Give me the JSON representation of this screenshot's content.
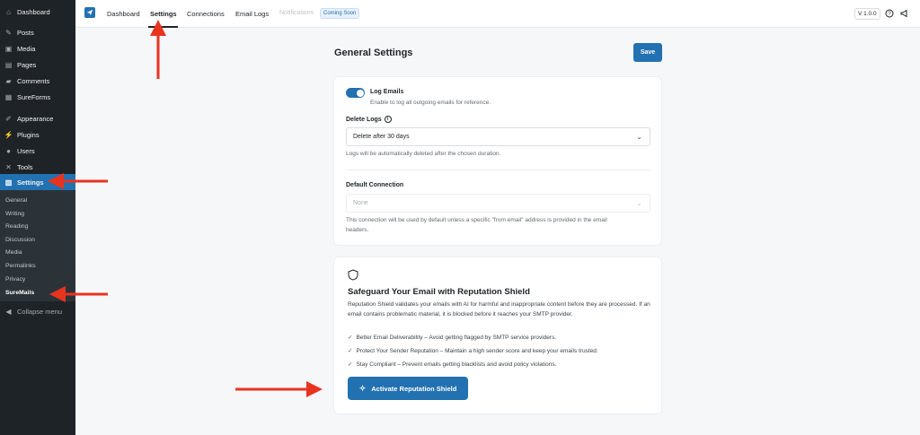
{
  "sidebar": {
    "items": [
      {
        "label": "Dashboard",
        "icon": "dashboard-icon",
        "glyph": "⌂"
      },
      {
        "label": "Posts",
        "icon": "pin-icon",
        "glyph": "✎"
      },
      {
        "label": "Media",
        "icon": "media-icon",
        "glyph": "▣"
      },
      {
        "label": "Pages",
        "icon": "pages-icon",
        "glyph": "▤"
      },
      {
        "label": "Comments",
        "icon": "comments-icon",
        "glyph": "▰"
      },
      {
        "label": "SureForms",
        "icon": "sureforms-icon",
        "glyph": "▦"
      },
      {
        "label": "Appearance",
        "icon": "brush-icon",
        "glyph": "✐"
      },
      {
        "label": "Plugins",
        "icon": "plugin-icon",
        "glyph": "⚡"
      },
      {
        "label": "Users",
        "icon": "users-icon",
        "glyph": "●"
      },
      {
        "label": "Tools",
        "icon": "wrench-icon",
        "glyph": "✕"
      },
      {
        "label": "Settings",
        "icon": "settings-icon",
        "glyph": "▥"
      }
    ],
    "submenu": [
      "General",
      "Writing",
      "Reading",
      "Discussion",
      "Media",
      "Permalinks",
      "Privacy",
      "SureMails"
    ],
    "collapse_label": "Collapse menu"
  },
  "topbar": {
    "nav": [
      "Dashboard",
      "Settings",
      "Connections",
      "Email Logs"
    ],
    "notifications": "Notifications",
    "coming_soon": "Coming Soon",
    "version": "V 1.0.0"
  },
  "main": {
    "title": "General Settings",
    "save_label": "Save",
    "log_emails": {
      "label": "Log Emails",
      "help": "Enable to log all outgoing emails for reference.",
      "enabled": true
    },
    "delete_logs": {
      "label": "Delete Logs",
      "value": "Delete after 30 days",
      "help": "Logs will be automatically deleted after the chosen duration."
    },
    "default_connection": {
      "label": "Default Connection",
      "placeholder": "None",
      "help_line1": "This connection will be used by default unless a specific \"from email\" address is provided in the email",
      "help_line2": "headers."
    }
  },
  "shield": {
    "title": "Safeguard Your Email with Reputation Shield",
    "description": "Reputation Shield validates your emails with AI for harmful and inappropriate content before they are processed. If an email contains problematic material, it is blocked before it reaches your SMTP provider.",
    "features": [
      "Better Email Deliverability – Avoid getting flagged by SMTP service providers.",
      "Protect Your Sender Reputation – Maintain a high sender score and keep your emails trusted.",
      "Stay Compliant – Prevent emails getting blacklists and avoid policy violations."
    ],
    "button_label": "Activate Reputation Shield"
  },
  "colors": {
    "accent": "#2271b1",
    "annotation_arrow": "#e8331f"
  }
}
